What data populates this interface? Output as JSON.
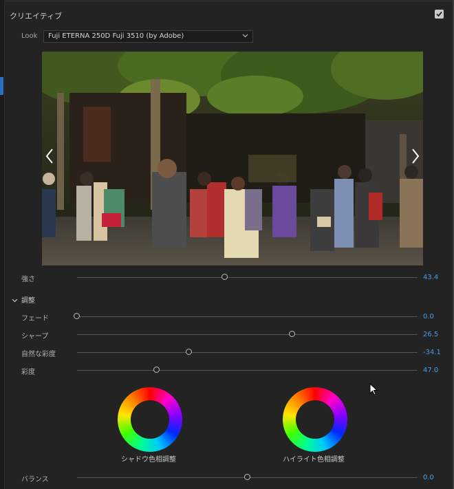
{
  "panel": {
    "section_title": "クリエイティブ",
    "look_label": "Look",
    "look_value": "Fuji ETERNA 250D Fuji 3510 (by Adobe)"
  },
  "intensity": {
    "label": "強さ",
    "value": "43.4",
    "level": 0.434
  },
  "adjustments": {
    "header": "調整",
    "sliders": [
      {
        "label": "フェード",
        "value": "0.0",
        "level": 0.0
      },
      {
        "label": "シャープ",
        "value": "26.5",
        "level": 0.632
      },
      {
        "label": "自然な彩度",
        "value": "-34.1",
        "level": 0.329
      },
      {
        "label": "彩度",
        "value": "47.0",
        "level": 0.235
      }
    ]
  },
  "wheels": {
    "shadow_label": "シャドウ色相調整",
    "highlight_label": "ハイライト色相調整"
  },
  "balance": {
    "label": "バランス",
    "value": "0.0",
    "level": 0.5
  },
  "colors": {
    "value_blue": "#4b9ee8",
    "panel_bg": "#232323"
  }
}
